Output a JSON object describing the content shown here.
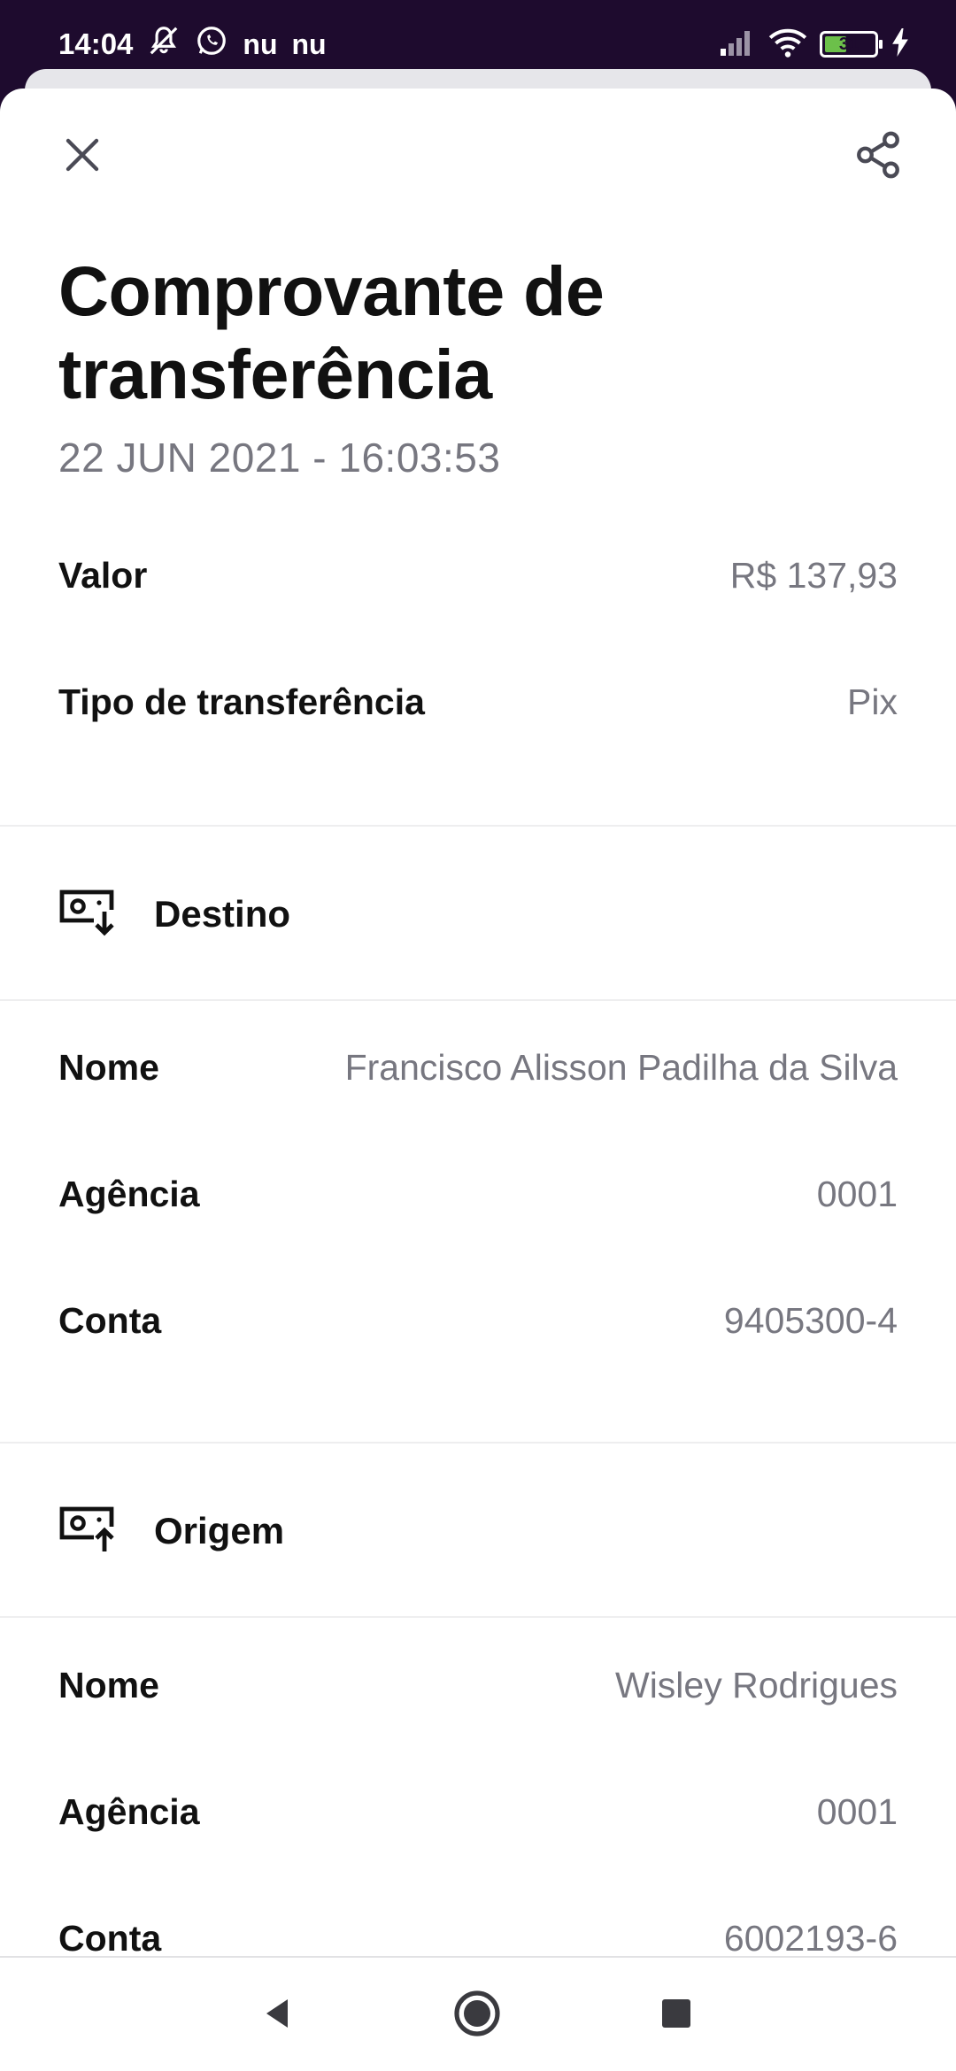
{
  "status_bar": {
    "time": "14:04",
    "notification_icons": [
      "mute-icon",
      "whatsapp-icon",
      "nu-icon",
      "nu-icon"
    ],
    "nu_labels": [
      "nu",
      "nu"
    ],
    "battery": "31"
  },
  "header": {
    "close_icon": "close-icon",
    "share_icon": "share-icon",
    "title": "Comprovante de transferência",
    "date": "22 JUN 2021 - 16:03:53"
  },
  "summary": {
    "amount_label": "Valor",
    "amount_value": "R$ 137,93",
    "type_label": "Tipo de transferência",
    "type_value": "Pix"
  },
  "destination": {
    "section_label": "Destino",
    "icon": "receive-money-icon",
    "name_label": "Nome",
    "name_value": "Francisco Alisson Padilha da Silva",
    "agency_label": "Agência",
    "agency_value": "0001",
    "account_label": "Conta",
    "account_value": "9405300-4"
  },
  "origin": {
    "section_label": "Origem",
    "icon": "send-money-icon",
    "name_label": "Nome",
    "name_value": "Wisley Rodrigues",
    "agency_label": "Agência",
    "agency_value": "0001",
    "account_label": "Conta",
    "account_value": "6002193-6"
  },
  "navigation": {
    "back_icon": "back-icon",
    "home_icon": "home-icon",
    "recents_icon": "recents-icon"
  },
  "colors": {
    "status_bar_bg": "#1e0b2e",
    "text_primary": "#111111",
    "text_secondary": "#777780",
    "divider": "#eeeeef"
  }
}
